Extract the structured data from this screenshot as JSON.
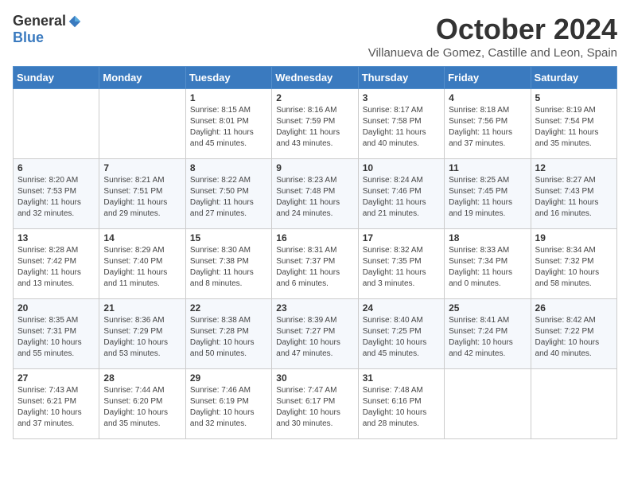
{
  "header": {
    "logo_general": "General",
    "logo_blue": "Blue",
    "month_title": "October 2024",
    "location": "Villanueva de Gomez, Castille and Leon, Spain"
  },
  "calendar": {
    "days_of_week": [
      "Sunday",
      "Monday",
      "Tuesday",
      "Wednesday",
      "Thursday",
      "Friday",
      "Saturday"
    ],
    "weeks": [
      [
        {
          "day": "",
          "info": ""
        },
        {
          "day": "",
          "info": ""
        },
        {
          "day": "1",
          "info": "Sunrise: 8:15 AM\nSunset: 8:01 PM\nDaylight: 11 hours and 45 minutes."
        },
        {
          "day": "2",
          "info": "Sunrise: 8:16 AM\nSunset: 7:59 PM\nDaylight: 11 hours and 43 minutes."
        },
        {
          "day": "3",
          "info": "Sunrise: 8:17 AM\nSunset: 7:58 PM\nDaylight: 11 hours and 40 minutes."
        },
        {
          "day": "4",
          "info": "Sunrise: 8:18 AM\nSunset: 7:56 PM\nDaylight: 11 hours and 37 minutes."
        },
        {
          "day": "5",
          "info": "Sunrise: 8:19 AM\nSunset: 7:54 PM\nDaylight: 11 hours and 35 minutes."
        }
      ],
      [
        {
          "day": "6",
          "info": "Sunrise: 8:20 AM\nSunset: 7:53 PM\nDaylight: 11 hours and 32 minutes."
        },
        {
          "day": "7",
          "info": "Sunrise: 8:21 AM\nSunset: 7:51 PM\nDaylight: 11 hours and 29 minutes."
        },
        {
          "day": "8",
          "info": "Sunrise: 8:22 AM\nSunset: 7:50 PM\nDaylight: 11 hours and 27 minutes."
        },
        {
          "day": "9",
          "info": "Sunrise: 8:23 AM\nSunset: 7:48 PM\nDaylight: 11 hours and 24 minutes."
        },
        {
          "day": "10",
          "info": "Sunrise: 8:24 AM\nSunset: 7:46 PM\nDaylight: 11 hours and 21 minutes."
        },
        {
          "day": "11",
          "info": "Sunrise: 8:25 AM\nSunset: 7:45 PM\nDaylight: 11 hours and 19 minutes."
        },
        {
          "day": "12",
          "info": "Sunrise: 8:27 AM\nSunset: 7:43 PM\nDaylight: 11 hours and 16 minutes."
        }
      ],
      [
        {
          "day": "13",
          "info": "Sunrise: 8:28 AM\nSunset: 7:42 PM\nDaylight: 11 hours and 13 minutes."
        },
        {
          "day": "14",
          "info": "Sunrise: 8:29 AM\nSunset: 7:40 PM\nDaylight: 11 hours and 11 minutes."
        },
        {
          "day": "15",
          "info": "Sunrise: 8:30 AM\nSunset: 7:38 PM\nDaylight: 11 hours and 8 minutes."
        },
        {
          "day": "16",
          "info": "Sunrise: 8:31 AM\nSunset: 7:37 PM\nDaylight: 11 hours and 6 minutes."
        },
        {
          "day": "17",
          "info": "Sunrise: 8:32 AM\nSunset: 7:35 PM\nDaylight: 11 hours and 3 minutes."
        },
        {
          "day": "18",
          "info": "Sunrise: 8:33 AM\nSunset: 7:34 PM\nDaylight: 11 hours and 0 minutes."
        },
        {
          "day": "19",
          "info": "Sunrise: 8:34 AM\nSunset: 7:32 PM\nDaylight: 10 hours and 58 minutes."
        }
      ],
      [
        {
          "day": "20",
          "info": "Sunrise: 8:35 AM\nSunset: 7:31 PM\nDaylight: 10 hours and 55 minutes."
        },
        {
          "day": "21",
          "info": "Sunrise: 8:36 AM\nSunset: 7:29 PM\nDaylight: 10 hours and 53 minutes."
        },
        {
          "day": "22",
          "info": "Sunrise: 8:38 AM\nSunset: 7:28 PM\nDaylight: 10 hours and 50 minutes."
        },
        {
          "day": "23",
          "info": "Sunrise: 8:39 AM\nSunset: 7:27 PM\nDaylight: 10 hours and 47 minutes."
        },
        {
          "day": "24",
          "info": "Sunrise: 8:40 AM\nSunset: 7:25 PM\nDaylight: 10 hours and 45 minutes."
        },
        {
          "day": "25",
          "info": "Sunrise: 8:41 AM\nSunset: 7:24 PM\nDaylight: 10 hours and 42 minutes."
        },
        {
          "day": "26",
          "info": "Sunrise: 8:42 AM\nSunset: 7:22 PM\nDaylight: 10 hours and 40 minutes."
        }
      ],
      [
        {
          "day": "27",
          "info": "Sunrise: 7:43 AM\nSunset: 6:21 PM\nDaylight: 10 hours and 37 minutes."
        },
        {
          "day": "28",
          "info": "Sunrise: 7:44 AM\nSunset: 6:20 PM\nDaylight: 10 hours and 35 minutes."
        },
        {
          "day": "29",
          "info": "Sunrise: 7:46 AM\nSunset: 6:19 PM\nDaylight: 10 hours and 32 minutes."
        },
        {
          "day": "30",
          "info": "Sunrise: 7:47 AM\nSunset: 6:17 PM\nDaylight: 10 hours and 30 minutes."
        },
        {
          "day": "31",
          "info": "Sunrise: 7:48 AM\nSunset: 6:16 PM\nDaylight: 10 hours and 28 minutes."
        },
        {
          "day": "",
          "info": ""
        },
        {
          "day": "",
          "info": ""
        }
      ]
    ]
  }
}
